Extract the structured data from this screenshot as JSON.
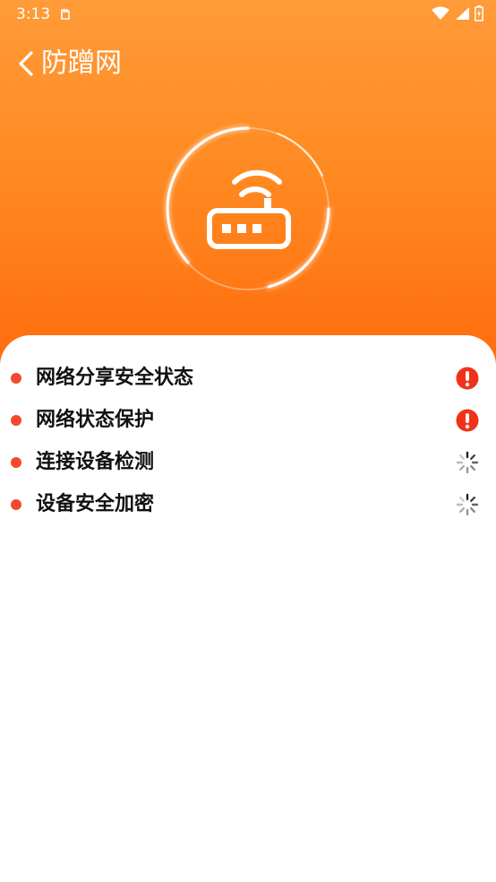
{
  "status_bar": {
    "time": "3:13"
  },
  "header": {
    "title": "防蹭网"
  },
  "colors": {
    "accent": "#ff8a22",
    "danger": "#f0321a",
    "bullet": "#f24a2e"
  },
  "checks": [
    {
      "label": "网络分享安全状态",
      "status": "warning"
    },
    {
      "label": "网络状态保护",
      "status": "warning"
    },
    {
      "label": "连接设备检测",
      "status": "loading"
    },
    {
      "label": "设备安全加密",
      "status": "loading"
    }
  ]
}
